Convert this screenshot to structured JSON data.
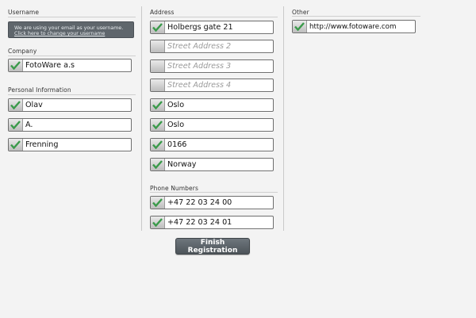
{
  "username": {
    "title": "Username",
    "notice_line1": "We are using your email as your username.",
    "notice_link": "Click here to change your username"
  },
  "company": {
    "title": "Company",
    "name": {
      "value": "FotoWare a.s",
      "checked": true
    }
  },
  "personal": {
    "title": "Personal Information",
    "first_name": {
      "value": "Olav",
      "checked": true
    },
    "middle": {
      "value": "A.",
      "checked": true
    },
    "last_name": {
      "value": "Frenning",
      "checked": true
    }
  },
  "address": {
    "title": "Address",
    "street1": {
      "value": "Holbergs gate 21",
      "checked": true
    },
    "street2": {
      "placeholder": "Street Address 2",
      "checked": false
    },
    "street3": {
      "placeholder": "Street Address 3",
      "checked": false
    },
    "street4": {
      "placeholder": "Street Address 4",
      "checked": false
    },
    "city": {
      "value": "Oslo",
      "checked": true
    },
    "region": {
      "value": "Oslo",
      "checked": true
    },
    "postal": {
      "value": "0166",
      "checked": true
    },
    "country": {
      "value": "Norway",
      "checked": true
    }
  },
  "phones": {
    "title": "Phone Numbers",
    "phone1": {
      "value": "+47 22 03 24 00",
      "checked": true
    },
    "phone2": {
      "value": "+47 22 03 24 01",
      "checked": true
    }
  },
  "other": {
    "title": "Other",
    "url": {
      "value": "http://www.fotoware.com",
      "checked": true
    }
  },
  "finish_label": "Finish Registration",
  "icons": {
    "checkbox_check": "green-checkmark-icon"
  },
  "colors": {
    "check": "#3a9a4a",
    "notice_bg": "#5f666c",
    "button_bg": "#5a6166"
  }
}
